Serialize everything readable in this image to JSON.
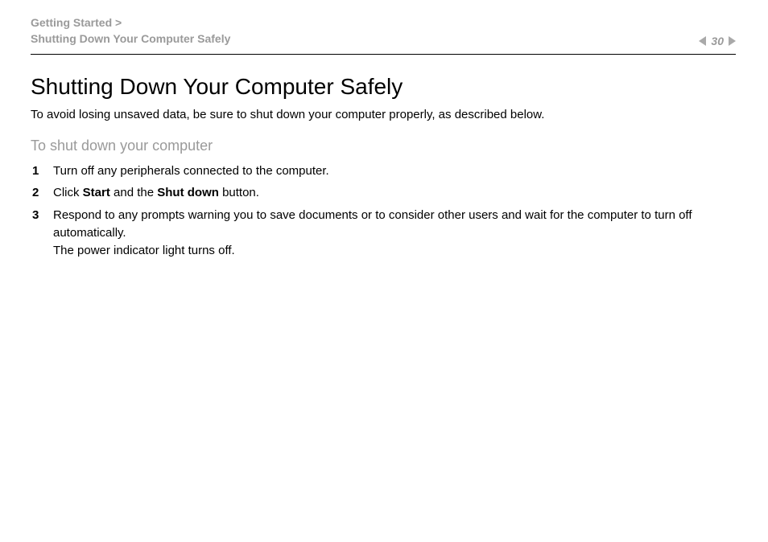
{
  "header": {
    "breadcrumb_line1": "Getting Started >",
    "breadcrumb_line2": "Shutting Down Your Computer Safely",
    "page_number": "30"
  },
  "main": {
    "title": "Shutting Down Your Computer Safely",
    "intro": "To avoid losing unsaved data, be sure to shut down your computer properly, as described below.",
    "subhead": "To shut down your computer",
    "steps": [
      {
        "segments": [
          {
            "text": "Turn off any peripherals connected to the computer."
          }
        ]
      },
      {
        "segments": [
          {
            "text": "Click "
          },
          {
            "text": "Start",
            "bold": true
          },
          {
            "text": " and the "
          },
          {
            "text": "Shut down",
            "bold": true
          },
          {
            "text": " button."
          }
        ]
      },
      {
        "segments": [
          {
            "text": "Respond to any prompts warning you to save documents or to consider other users and wait for the computer to turn off automatically."
          },
          {
            "br": true
          },
          {
            "text": "The power indicator light turns off."
          }
        ]
      }
    ]
  }
}
